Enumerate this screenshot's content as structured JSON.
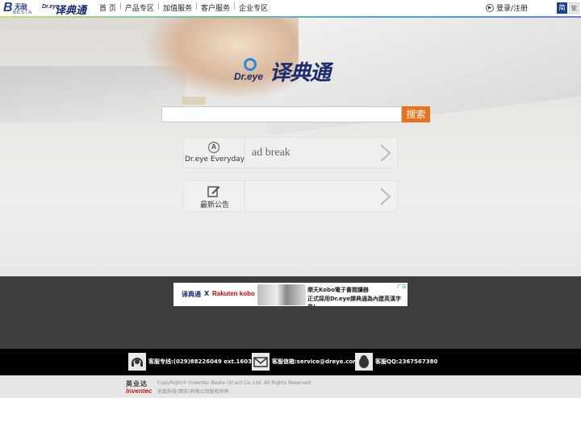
{
  "header": {
    "brand": {
      "besta_cn": "无敌",
      "besta_en": "BESTA",
      "dreye_en": "Dr.eye",
      "dreye_cn": "译典通"
    },
    "nav": [
      "首 页",
      "产品专区",
      "加值服务",
      "客户服务",
      "企业专区"
    ],
    "login": "登录/注册",
    "lang": {
      "simplified": "简",
      "traditional": "繁"
    }
  },
  "hero": {
    "logo_en": "Dr.eye",
    "logo_cn": "译典通",
    "search": {
      "value": "",
      "placeholder": "",
      "button": "搜索"
    },
    "cards": [
      {
        "label": "Dr.eye Everyday",
        "icon": "letter-a-circle-icon",
        "content": "ad break"
      },
      {
        "label": "最新公告",
        "icon": "edit-pencil-icon",
        "content": ""
      }
    ]
  },
  "banner": {
    "brand_cn": "译典通",
    "separator": "X",
    "brand_partner": "Rakuten kobo",
    "line1": "樂天Kobo電子書閱讀器",
    "line2": "正式採用Dr.eye譯典通為內建英漢字典!",
    "ad_tag": "广告"
  },
  "contact": {
    "phone": "客服专线:(029)88226049 ext.1603",
    "email": "客服信箱:service@dreye.com",
    "qq": "客服QQ:2367567380"
  },
  "footer": {
    "logo_cn": "英业达",
    "logo_en": "Inventec",
    "copyright_en": "CopyRight© Inventec Besta (Xi'an) Co.,Ltd. All Rights Reserved",
    "copyright_cn": "无敌科技(西安)有限公司版权所有"
  },
  "colors": {
    "accent": "#e8731f",
    "brand_blue": "#1d2c6e",
    "dark_band": "#3e3e3e",
    "contact_bar": "#000000"
  }
}
